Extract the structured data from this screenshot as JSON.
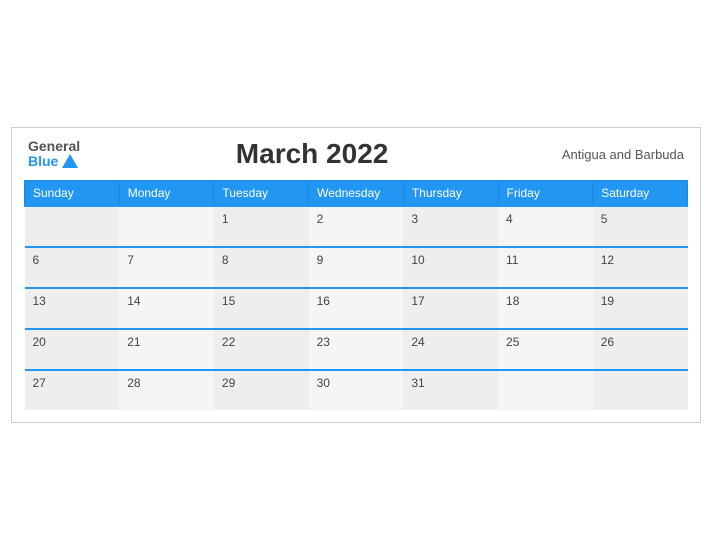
{
  "header": {
    "logo_general": "General",
    "logo_blue": "Blue",
    "title": "March 2022",
    "region": "Antigua and Barbuda"
  },
  "weekdays": [
    "Sunday",
    "Monday",
    "Tuesday",
    "Wednesday",
    "Thursday",
    "Friday",
    "Saturday"
  ],
  "weeks": [
    [
      {
        "day": "",
        "empty": true
      },
      {
        "day": "",
        "empty": true
      },
      {
        "day": "1"
      },
      {
        "day": "2"
      },
      {
        "day": "3"
      },
      {
        "day": "4"
      },
      {
        "day": "5"
      }
    ],
    [
      {
        "day": "6"
      },
      {
        "day": "7"
      },
      {
        "day": "8"
      },
      {
        "day": "9"
      },
      {
        "day": "10"
      },
      {
        "day": "11"
      },
      {
        "day": "12"
      }
    ],
    [
      {
        "day": "13"
      },
      {
        "day": "14"
      },
      {
        "day": "15"
      },
      {
        "day": "16"
      },
      {
        "day": "17"
      },
      {
        "day": "18"
      },
      {
        "day": "19"
      }
    ],
    [
      {
        "day": "20"
      },
      {
        "day": "21"
      },
      {
        "day": "22"
      },
      {
        "day": "23"
      },
      {
        "day": "24"
      },
      {
        "day": "25"
      },
      {
        "day": "26"
      }
    ],
    [
      {
        "day": "27"
      },
      {
        "day": "28"
      },
      {
        "day": "29"
      },
      {
        "day": "30"
      },
      {
        "day": "31"
      },
      {
        "day": "",
        "empty": true
      },
      {
        "day": "",
        "empty": true
      }
    ]
  ]
}
